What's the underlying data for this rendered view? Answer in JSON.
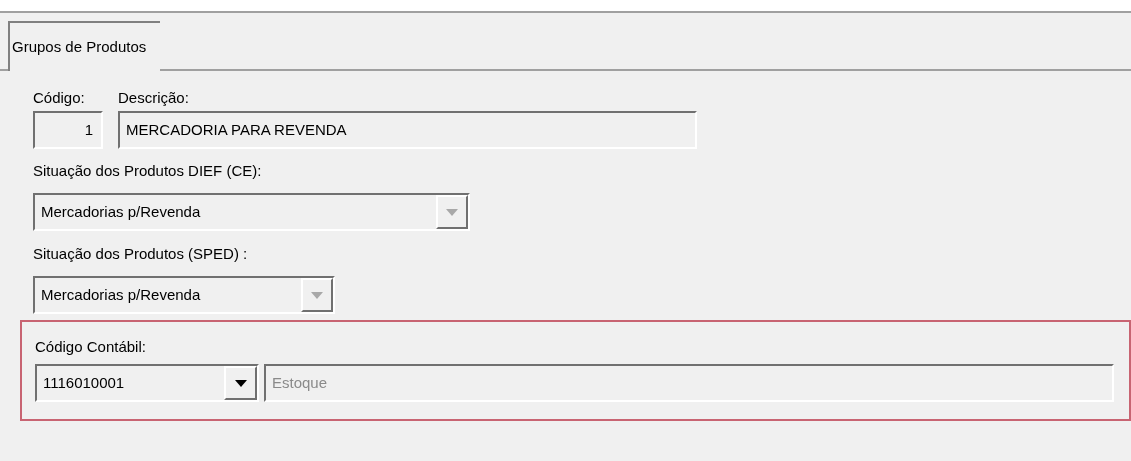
{
  "tabs": [
    {
      "label": "Grupos de Produtos",
      "selected": true
    }
  ],
  "codigo": {
    "label": "Código:",
    "value": "1"
  },
  "descricao": {
    "label": "Descrição:",
    "value": "MERCADORIA PARA REVENDA"
  },
  "dief": {
    "label": "Situação dos Produtos DIEF (CE):",
    "value": "Mercadorias p/Revenda",
    "disabled": true
  },
  "sped": {
    "label": "Situação dos Produtos (SPED) :",
    "value": "Mercadorias p/Revenda",
    "disabled": true
  },
  "codigo_contabil": {
    "label": "Código Contábil:",
    "value": "1116010001",
    "disabled": false,
    "highlighted": true,
    "description": {
      "value": "Estoque",
      "disabled": true
    }
  }
}
